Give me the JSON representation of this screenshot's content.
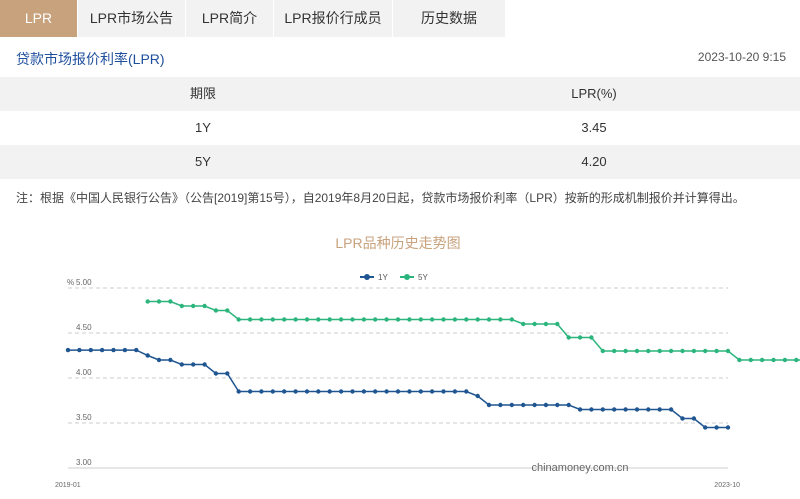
{
  "tabs": [
    {
      "label": "LPR",
      "active": true
    },
    {
      "label": "LPR市场公告",
      "active": false
    },
    {
      "label": "LPR简介",
      "active": false
    },
    {
      "label": "LPR报价行成员",
      "active": false
    },
    {
      "label": "历史数据",
      "active": false
    }
  ],
  "header": {
    "title": "贷款市场报价利率(LPR)",
    "timestamp": "2023-10-20 9:15"
  },
  "table": {
    "columns": [
      "期限",
      "LPR(%)"
    ],
    "rows": [
      [
        "1Y",
        "3.45"
      ],
      [
        "5Y",
        "4.20"
      ]
    ]
  },
  "note": "注：根据《中国人民银行公告》（公告[2019]第15号），自2019年8月20日起，贷款市场报价利率（LPR）按新的形成机制报价并计算得出。",
  "colors": {
    "accent": "#c8a27c",
    "title_blue": "#1e4f9c",
    "series_1y": "#1f5591",
    "series_5y": "#2bb57c"
  },
  "chart_data": {
    "type": "line",
    "title": "LPR品种历史走势图",
    "ylabel": "%",
    "xlabel": "",
    "ylim": [
      3.0,
      5.0
    ],
    "yticks": [
      "5.00",
      "4.50",
      "4.00",
      "3.50",
      "3.00"
    ],
    "x_start_label": "2019-01",
    "x_end_label": "2023-10",
    "legend_position": "top-center",
    "grid": true,
    "watermark": "chinamoney.com.cn",
    "series": [
      {
        "name": "1Y",
        "color": "#1f5591",
        "values": [
          4.31,
          4.31,
          4.31,
          4.31,
          4.31,
          4.31,
          4.31,
          4.25,
          4.2,
          4.2,
          4.15,
          4.15,
          4.15,
          4.05,
          4.05,
          3.85,
          3.85,
          3.85,
          3.85,
          3.85,
          3.85,
          3.85,
          3.85,
          3.85,
          3.85,
          3.85,
          3.85,
          3.85,
          3.85,
          3.85,
          3.85,
          3.85,
          3.85,
          3.85,
          3.85,
          3.85,
          3.8,
          3.7,
          3.7,
          3.7,
          3.7,
          3.7,
          3.7,
          3.7,
          3.7,
          3.65,
          3.65,
          3.65,
          3.65,
          3.65,
          3.65,
          3.65,
          3.65,
          3.65,
          3.55,
          3.55,
          3.45,
          3.45,
          3.45
        ]
      },
      {
        "name": "5Y",
        "color": "#2bb57c",
        "start_index": 7,
        "values": [
          4.85,
          4.85,
          4.85,
          4.8,
          4.8,
          4.8,
          4.75,
          4.75,
          4.65,
          4.65,
          4.65,
          4.65,
          4.65,
          4.65,
          4.65,
          4.65,
          4.65,
          4.65,
          4.65,
          4.65,
          4.65,
          4.65,
          4.65,
          4.65,
          4.65,
          4.65,
          4.65,
          4.65,
          4.65,
          4.65,
          4.65,
          4.65,
          4.65,
          4.6,
          4.6,
          4.6,
          4.6,
          4.45,
          4.45,
          4.45,
          4.3,
          4.3,
          4.3,
          4.3,
          4.3,
          4.3,
          4.3,
          4.3,
          4.3,
          4.3,
          4.3,
          4.3,
          4.2,
          4.2,
          4.2,
          4.2,
          4.2,
          4.2,
          4.2
        ]
      }
    ]
  }
}
